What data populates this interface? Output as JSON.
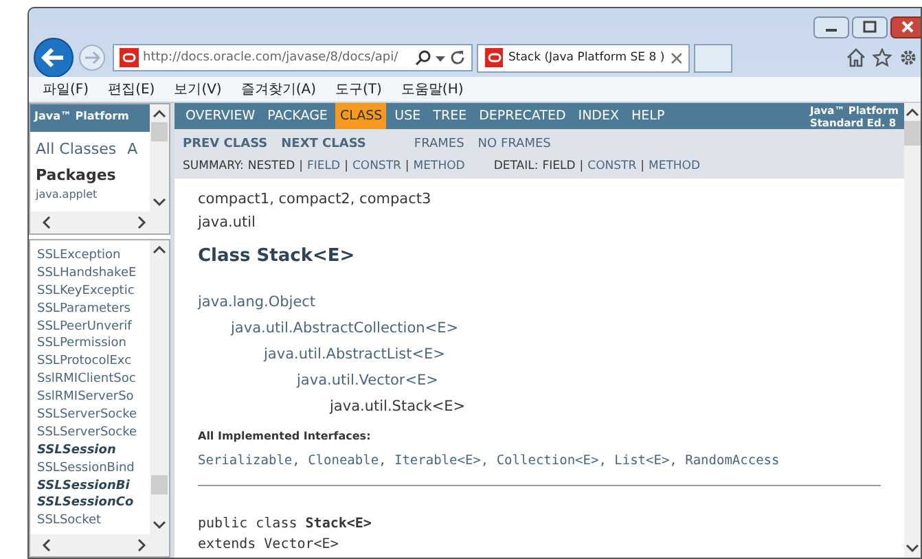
{
  "browser": {
    "address": "http://docs.oracle.com/javase/8/docs/api/",
    "tabs": [
      {
        "title": "Stack (Java Platform SE 8 )",
        "selected": true
      }
    ]
  },
  "menu": [
    "파일(F)",
    "편집(E)",
    "보기(V)",
    "즐겨찾기(A)",
    "도구(T)",
    "도움말(H)"
  ],
  "package_frame": {
    "header": "Java™ Platform",
    "links": [
      "All Classes",
      "A"
    ],
    "heading": "Packages",
    "packages": [
      "java.applet"
    ]
  },
  "class_frame": {
    "classes": [
      {
        "name": "SSLException",
        "kind": "class"
      },
      {
        "name": "SSLHandshakeE",
        "kind": "class"
      },
      {
        "name": "SSLKeyExceptic",
        "kind": "class"
      },
      {
        "name": "SSLParameters",
        "kind": "class"
      },
      {
        "name": "SSLPeerUnverif",
        "kind": "class"
      },
      {
        "name": "SSLPermission",
        "kind": "class"
      },
      {
        "name": "SSLProtocolExc",
        "kind": "class"
      },
      {
        "name": "SslRMIClientSoc",
        "kind": "class"
      },
      {
        "name": "SslRMIServerSo",
        "kind": "class"
      },
      {
        "name": "SSLServerSocke",
        "kind": "class"
      },
      {
        "name": "SSLServerSocke",
        "kind": "class"
      },
      {
        "name": "SSLSession",
        "kind": "interface"
      },
      {
        "name": "SSLSessionBind",
        "kind": "class"
      },
      {
        "name": "SSLSessionBi",
        "kind": "interface"
      },
      {
        "name": "SSLSessionCo",
        "kind": "interface"
      },
      {
        "name": "SSLSocket",
        "kind": "class"
      }
    ]
  },
  "doc": {
    "nav": [
      {
        "label": "OVERVIEW",
        "selected": false
      },
      {
        "label": "PACKAGE",
        "selected": false
      },
      {
        "label": "CLASS",
        "selected": true
      },
      {
        "label": "USE",
        "selected": false
      },
      {
        "label": "TREE",
        "selected": false
      },
      {
        "label": "DEPRECATED",
        "selected": false
      },
      {
        "label": "INDEX",
        "selected": false
      },
      {
        "label": "HELP",
        "selected": false
      }
    ],
    "platform": [
      "Java™ Platform",
      "Standard Ed. 8"
    ],
    "prev_next": [
      "PREV CLASS",
      "NEXT CLASS"
    ],
    "frames": [
      "FRAMES",
      "NO FRAMES"
    ],
    "summary": {
      "label": "SUMMARY:",
      "separator": "|",
      "items": [
        {
          "text": "NESTED",
          "link": false
        },
        {
          "text": "FIELD",
          "link": true
        },
        {
          "text": "CONSTR",
          "link": true
        },
        {
          "text": "METHOD",
          "link": true
        }
      ]
    },
    "detail": {
      "label": "DETAIL:",
      "separator": "|",
      "items": [
        {
          "text": "FIELD",
          "link": false
        },
        {
          "text": "CONSTR",
          "link": true
        },
        {
          "text": "METHOD",
          "link": true
        }
      ]
    },
    "profiles": "compact1, compact2, compact3",
    "package": "java.util",
    "title": "Class Stack<E>",
    "hierarchy": [
      {
        "text": "java.lang.Object",
        "children": [
          {
            "text": "java.util.AbstractCollection<E>",
            "children": [
              {
                "text": "java.util.AbstractList<E>",
                "children": [
                  {
                    "text": "java.util.Vector<E>",
                    "children": [
                      {
                        "text": "java.util.Stack<E>"
                      }
                    ]
                  }
                ]
              }
            ]
          }
        ]
      }
    ],
    "interfaces_heading": "All Implemented Interfaces:",
    "interfaces": "Serializable, Cloneable, Iterable<E>, Collection<E>, List<E>, RandomAccess",
    "declaration": [
      "public class **Stack<E>**",
      "extends Vector<E>"
    ]
  }
}
